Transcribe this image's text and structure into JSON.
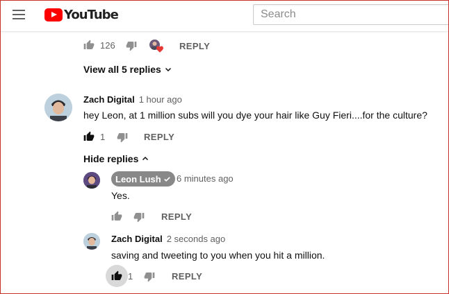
{
  "header": {
    "logo_text": "YouTube",
    "search_placeholder": "Search"
  },
  "top_action": {
    "like_count": "126",
    "reply_label": "REPLY"
  },
  "view_replies_label": "View all 5 replies",
  "comment": {
    "author": "Zach Digital",
    "time": "1 hour ago",
    "text": "hey Leon, at 1 million subs will you dye your hair like Guy Fieri....for the culture?",
    "like_count": "1",
    "reply_label": "REPLY"
  },
  "hide_replies_label": "Hide replies",
  "replies": [
    {
      "author": "Leon Lush",
      "time": "6 minutes ago",
      "text": "Yes.",
      "reply_label": "REPLY"
    },
    {
      "author": "Zach Digital",
      "time": "2 seconds ago",
      "text": "saving and tweeting to you when you hit a million.",
      "like_count": "1",
      "reply_label": "REPLY"
    }
  ],
  "colors": {
    "brand_red": "#ff0000",
    "owner_badge": "#888888",
    "heart": "#e53935"
  }
}
